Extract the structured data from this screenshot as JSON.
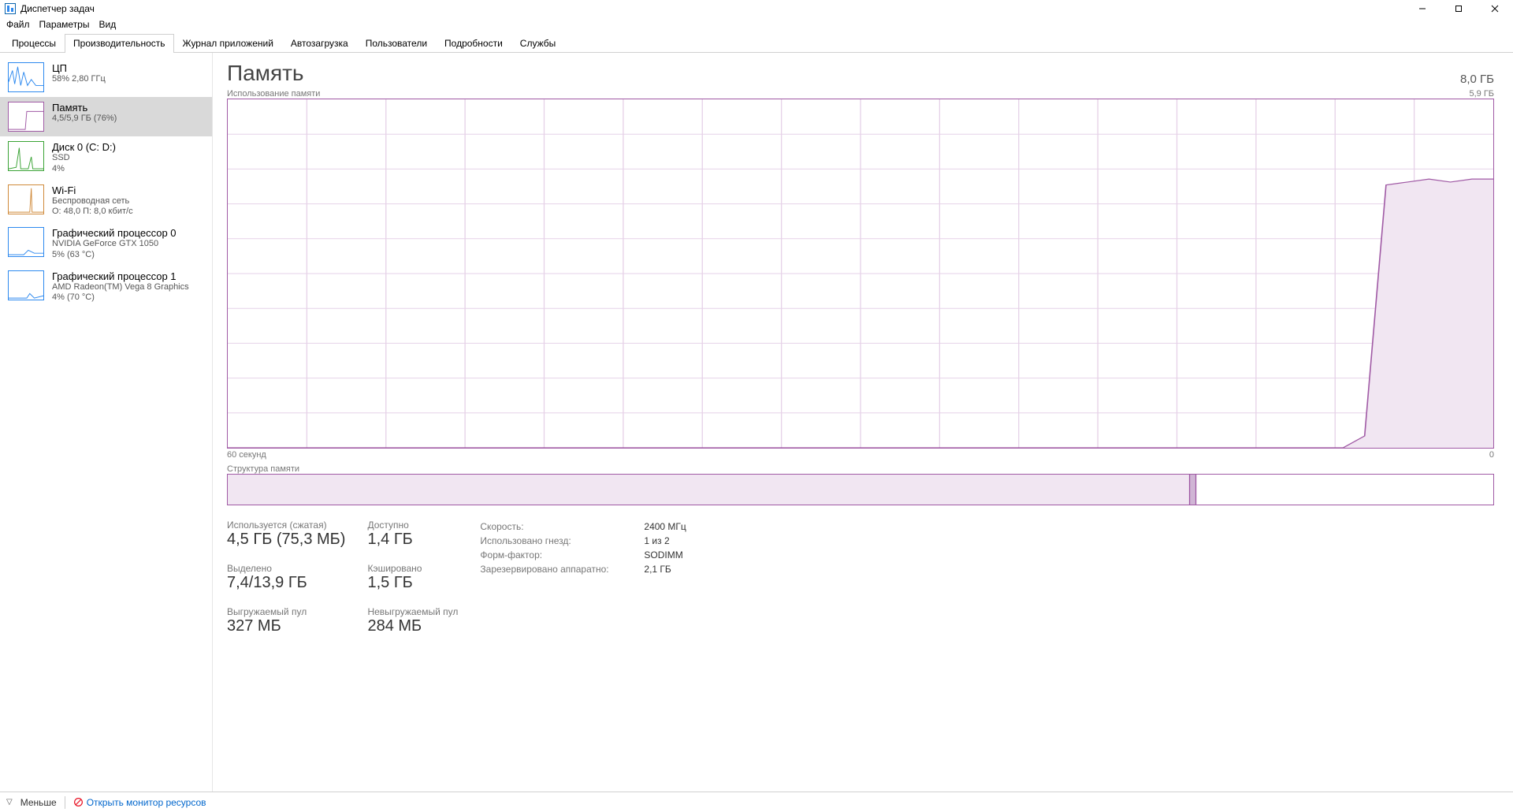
{
  "window": {
    "title": "Диспетчер задач",
    "menu": {
      "file": "Файл",
      "options": "Параметры",
      "view": "Вид"
    },
    "btn_min": "–",
    "btn_max": "▢",
    "btn_close": "✕"
  },
  "tabs": {
    "processes": "Процессы",
    "performance": "Производительность",
    "apphistory": "Журнал приложений",
    "startup": "Автозагрузка",
    "users": "Пользователи",
    "details": "Подробности",
    "services": "Службы"
  },
  "sidebar": {
    "cpu": {
      "title": "ЦП",
      "sub": "58% 2,80 ГГц"
    },
    "mem": {
      "title": "Память",
      "sub": "4,5/5,9 ГБ (76%)"
    },
    "disk": {
      "title": "Диск 0 (C: D:)",
      "sub1": "SSD",
      "sub2": "4%"
    },
    "wifi": {
      "title": "Wi-Fi",
      "sub1": "Беспроводная сеть",
      "sub2": "О: 48,0 П: 8,0 кбит/с"
    },
    "gpu0": {
      "title": "Графический процессор 0",
      "sub1": "NVIDIA GeForce GTX 1050",
      "sub2": "5%  (63 °C)"
    },
    "gpu1": {
      "title": "Графический процессор 1",
      "sub1": "AMD Radeon(TM) Vega 8 Graphics",
      "sub2": "4%  (70 °C)"
    }
  },
  "memory": {
    "heading": "Память",
    "total": "8,0 ГБ",
    "chart_title": "Использование памяти",
    "y_max_label": "5,9 ГБ",
    "x_left": "60 секунд",
    "x_right": "0",
    "comp_title": "Структура памяти",
    "stats": {
      "in_use_lbl": "Используется (сжатая)",
      "in_use_val": "4,5 ГБ (75,3 МБ)",
      "avail_lbl": "Доступно",
      "avail_val": "1,4 ГБ",
      "commit_lbl": "Выделено",
      "commit_val": "7,4/13,9 ГБ",
      "cached_lbl": "Кэшировано",
      "cached_val": "1,5 ГБ",
      "paged_lbl": "Выгружаемый пул",
      "paged_val": "327 МБ",
      "nonpaged_lbl": "Невыгружаемый пул",
      "nonpaged_val": "284 МБ"
    },
    "kv": {
      "speed_k": "Скорость:",
      "speed_v": "2400 МГц",
      "slots_k": "Использовано гнезд:",
      "slots_v": "1 из 2",
      "ff_k": "Форм-фактор:",
      "ff_v": "SODIMM",
      "hw_k": "Зарезервировано аппаратно:",
      "hw_v": "2,1 ГБ"
    }
  },
  "footer": {
    "less": "Меньше",
    "open_monitor": "Открыть монитор ресурсов"
  },
  "chart_data": {
    "type": "area",
    "title": "Использование памяти",
    "xlabel": "",
    "ylabel": "",
    "x_range_seconds": [
      60,
      0
    ],
    "ylim": [
      0,
      5.9
    ],
    "values_gb": [
      0,
      0,
      0,
      0,
      0,
      0,
      0,
      0,
      0,
      0,
      0,
      0,
      0,
      0,
      0,
      0,
      0,
      0,
      0,
      0,
      0,
      0,
      0,
      0,
      0,
      0,
      0,
      0,
      0,
      0,
      0,
      0,
      0,
      0,
      0,
      0,
      0,
      0,
      0,
      0,
      0,
      0,
      0,
      0,
      0,
      0,
      0,
      0,
      0,
      0,
      0,
      0,
      0,
      0.2,
      4.45,
      4.5,
      4.55,
      4.5,
      4.55,
      4.55
    ],
    "composition": {
      "in_use_frac": 0.76,
      "modified_frac": 0.005,
      "standby_frac": 0.235
    }
  },
  "colors": {
    "mem_stroke": "#a05aa5",
    "mem_fill": "#f1e6f2",
    "grid": "#e6d2e8"
  }
}
